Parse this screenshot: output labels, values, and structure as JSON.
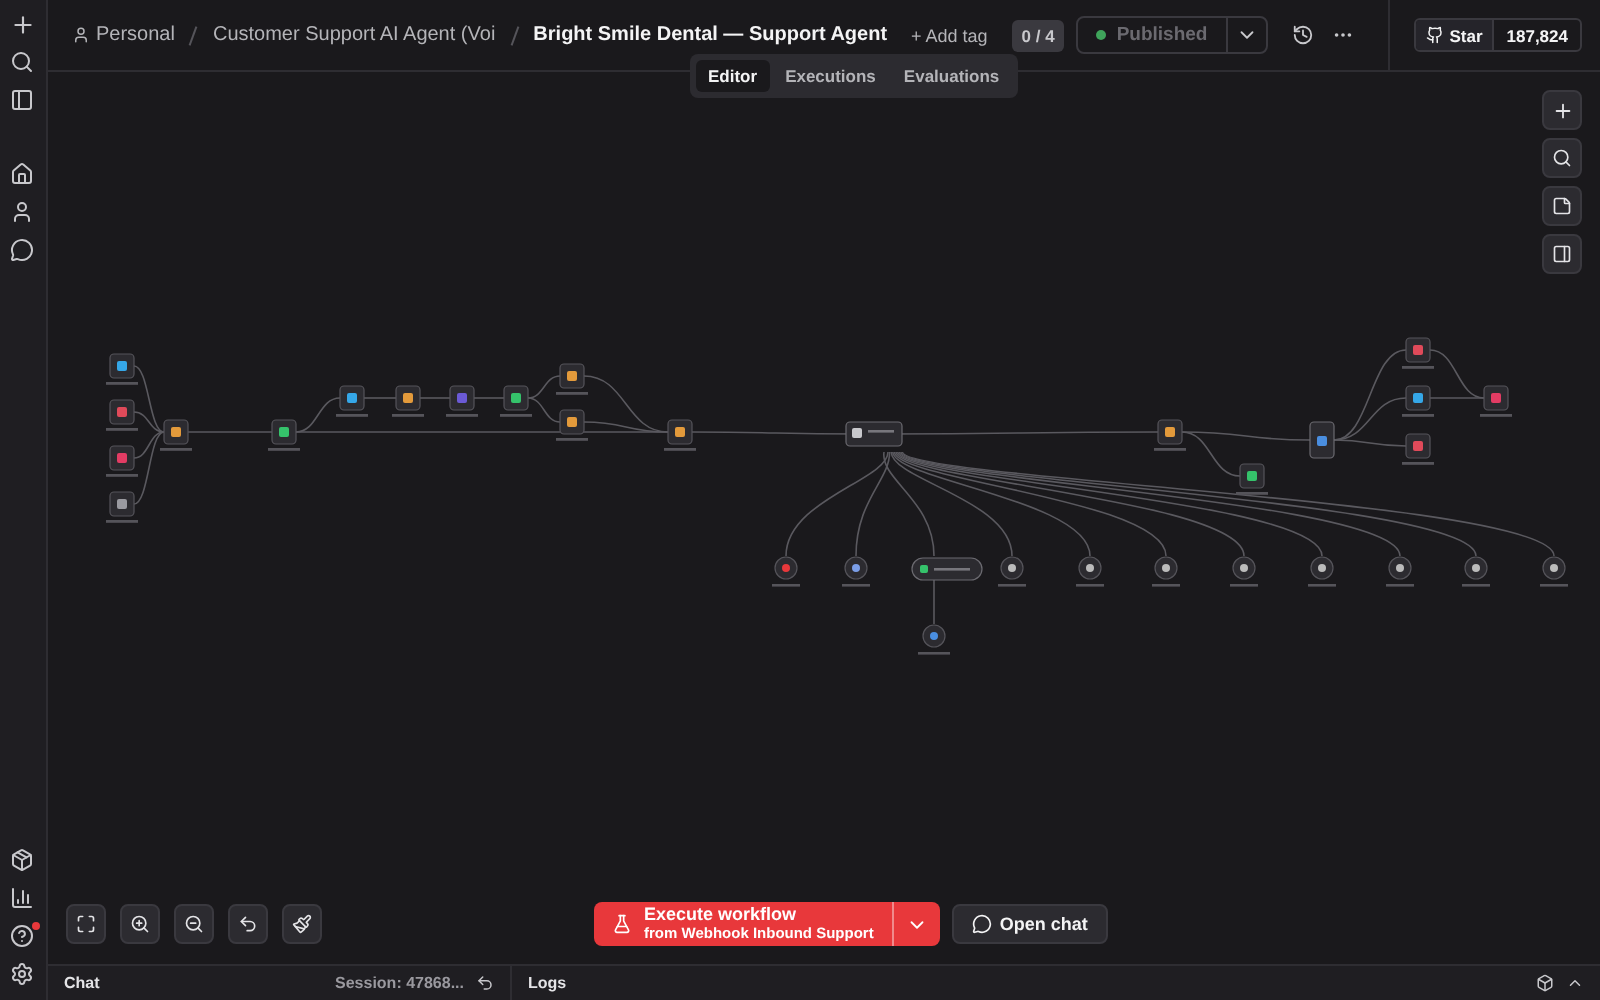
{
  "sidebar": {
    "help_notification": true
  },
  "breadcrumb": {
    "owner": "Personal",
    "folder": "Customer Support AI Agent (Voi",
    "workflow": "Bright Smile Dental — Support Agent",
    "add_tag": "+ Add tag"
  },
  "header": {
    "counter": "0 / 4",
    "publish": {
      "label": "Published",
      "live": true
    },
    "github": {
      "label": "Star",
      "count": "187,824"
    }
  },
  "tabs": [
    {
      "label": "Editor",
      "selected": true
    },
    {
      "label": "Executions",
      "selected": false
    },
    {
      "label": "Evaluations",
      "selected": false
    }
  ],
  "execute": {
    "title": "Execute workflow",
    "subtitle": "from Webhook Inbound Support"
  },
  "open_chat": "Open chat",
  "bottom_panel": {
    "chat": "Chat",
    "session": "Session: 47868...",
    "logs": "Logs"
  }
}
